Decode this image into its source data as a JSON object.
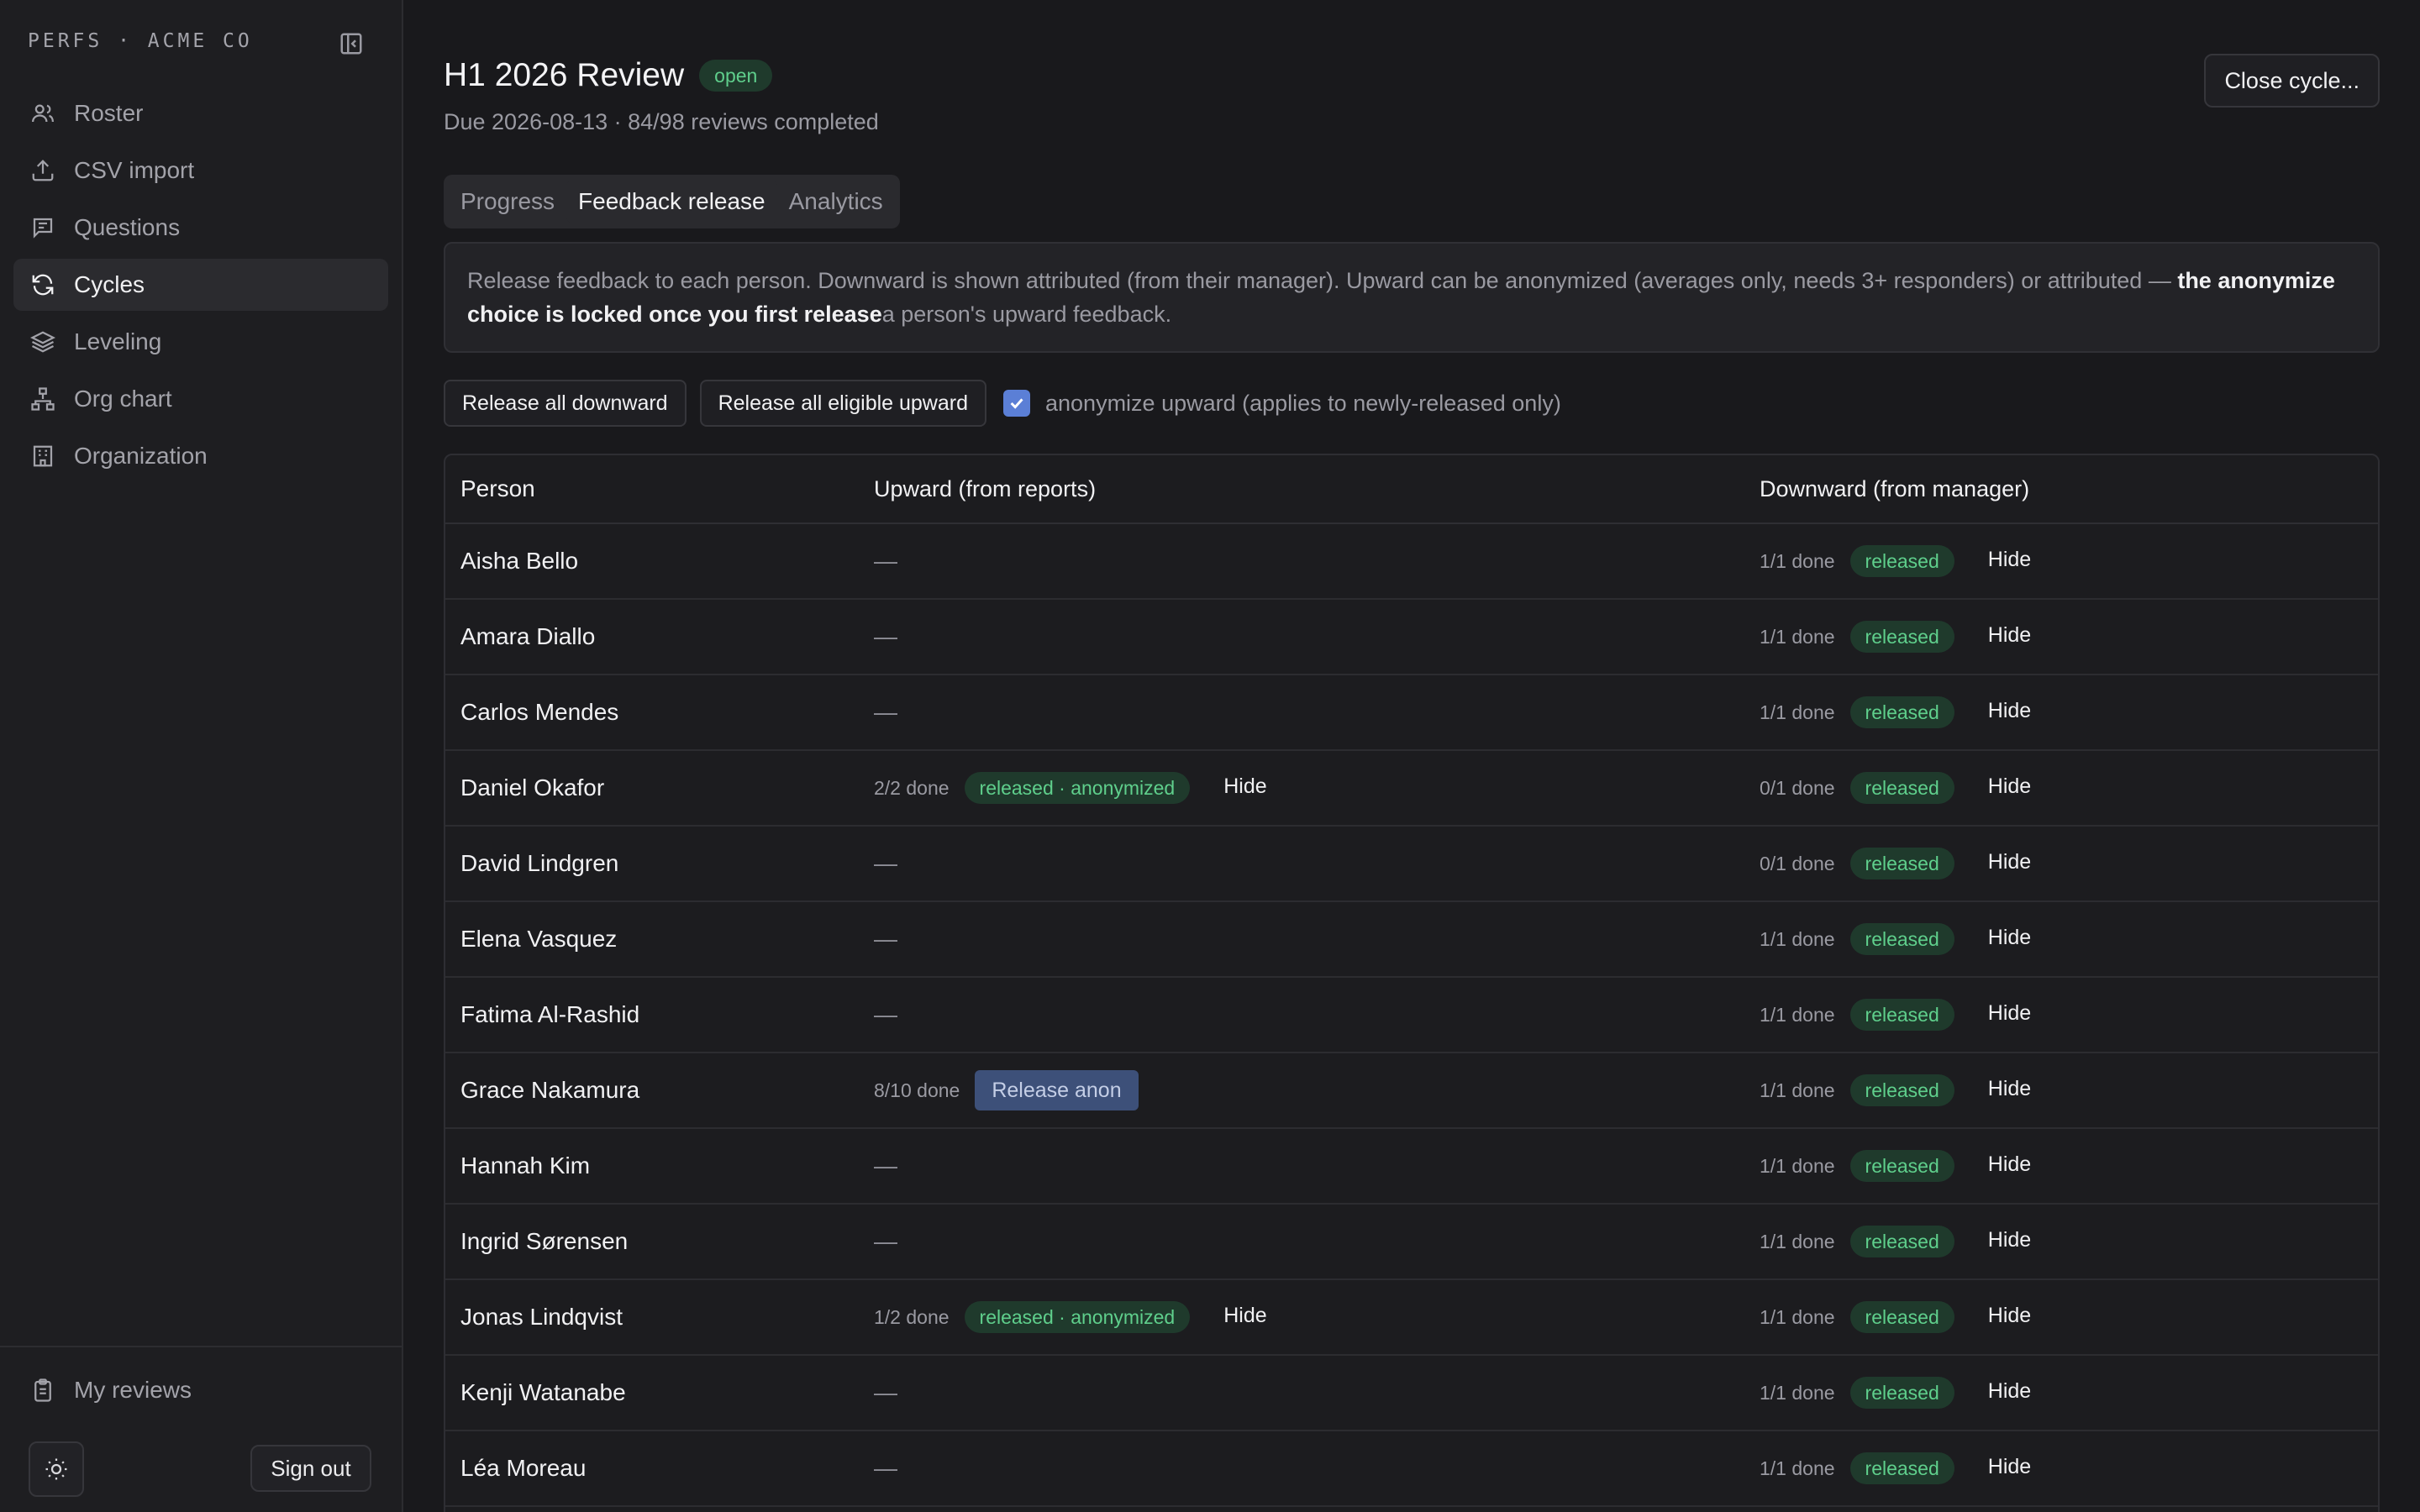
{
  "sidebar": {
    "brand": "PERFS · ACME CO",
    "items": [
      {
        "label": "Roster",
        "icon": "users-icon",
        "active": false
      },
      {
        "label": "CSV import",
        "icon": "upload-icon",
        "active": false
      },
      {
        "label": "Questions",
        "icon": "message-icon",
        "active": false
      },
      {
        "label": "Cycles",
        "icon": "refresh-icon",
        "active": true
      },
      {
        "label": "Leveling",
        "icon": "layers-icon",
        "active": false
      },
      {
        "label": "Org chart",
        "icon": "org-chart-icon",
        "active": false
      },
      {
        "label": "Organization",
        "icon": "building-icon",
        "active": false
      }
    ],
    "my_reviews": "My reviews",
    "sign_out": "Sign out"
  },
  "header": {
    "title": "H1 2026 Review",
    "status": "open",
    "subtitle": "Due 2026-08-13 · 84/98 reviews completed",
    "close_button": "Close cycle..."
  },
  "tabs": [
    {
      "label": "Progress",
      "active": false
    },
    {
      "label": "Feedback release",
      "active": true
    },
    {
      "label": "Analytics",
      "active": false
    }
  ],
  "info": {
    "text_before": "Release feedback to each person. Downward is shown attributed (from their manager). Upward can be anonymized (averages only, needs 3+ responders) or attributed — ",
    "text_bold": "the anonymize choice is locked once you first release",
    "text_after": "a person's upward feedback."
  },
  "actions": {
    "release_downward": "Release all downward",
    "release_upward": "Release all eligible upward",
    "anonymize_label": "anonymize upward (applies to newly-released only)",
    "anonymize_checked": true
  },
  "table": {
    "headers": [
      "Person",
      "Upward (from reports)",
      "Downward (from manager)"
    ],
    "rows": [
      {
        "person": "Aisha Bello",
        "up": {
          "type": "none",
          "text": "—"
        },
        "down": {
          "done": "1/1 done",
          "status": "released",
          "action": "Hide"
        }
      },
      {
        "person": "Amara Diallo",
        "up": {
          "type": "none",
          "text": "—"
        },
        "down": {
          "done": "1/1 done",
          "status": "released",
          "action": "Hide"
        }
      },
      {
        "person": "Carlos Mendes",
        "up": {
          "type": "none",
          "text": "—"
        },
        "down": {
          "done": "1/1 done",
          "status": "released",
          "action": "Hide"
        }
      },
      {
        "person": "Daniel Okafor",
        "up": {
          "type": "released",
          "done": "2/2 done",
          "status": "released · anonymized",
          "action": "Hide"
        },
        "down": {
          "done": "0/1 done",
          "status": "released",
          "action": "Hide"
        }
      },
      {
        "person": "David Lindgren",
        "up": {
          "type": "none",
          "text": "—"
        },
        "down": {
          "done": "0/1 done",
          "status": "released",
          "action": "Hide"
        }
      },
      {
        "person": "Elena Vasquez",
        "up": {
          "type": "none",
          "text": "—"
        },
        "down": {
          "done": "1/1 done",
          "status": "released",
          "action": "Hide"
        }
      },
      {
        "person": "Fatima Al-Rashid",
        "up": {
          "type": "none",
          "text": "—"
        },
        "down": {
          "done": "1/1 done",
          "status": "released",
          "action": "Hide"
        }
      },
      {
        "person": "Grace Nakamura",
        "up": {
          "type": "button",
          "done": "8/10 done",
          "button": "Release anon"
        },
        "down": {
          "done": "1/1 done",
          "status": "released",
          "action": "Hide"
        }
      },
      {
        "person": "Hannah Kim",
        "up": {
          "type": "none",
          "text": "—"
        },
        "down": {
          "done": "1/1 done",
          "status": "released",
          "action": "Hide"
        }
      },
      {
        "person": "Ingrid Sørensen",
        "up": {
          "type": "none",
          "text": "—"
        },
        "down": {
          "done": "1/1 done",
          "status": "released",
          "action": "Hide"
        }
      },
      {
        "person": "Jonas Lindqvist",
        "up": {
          "type": "released",
          "done": "1/2 done",
          "status": "released · anonymized",
          "action": "Hide"
        },
        "down": {
          "done": "1/1 done",
          "status": "released",
          "action": "Hide"
        }
      },
      {
        "person": "Kenji Watanabe",
        "up": {
          "type": "none",
          "text": "—"
        },
        "down": {
          "done": "1/1 done",
          "status": "released",
          "action": "Hide"
        }
      },
      {
        "person": "Léa Moreau",
        "up": {
          "type": "none",
          "text": "—"
        },
        "down": {
          "done": "1/1 done",
          "status": "released",
          "action": "Hide"
        }
      }
    ]
  },
  "colors": {
    "background": "#19191c",
    "sidebar": "#1e1e21",
    "accent": "#5b7fd6",
    "success_text": "#5fcf8c",
    "success_bg": "#1f3a2c"
  }
}
